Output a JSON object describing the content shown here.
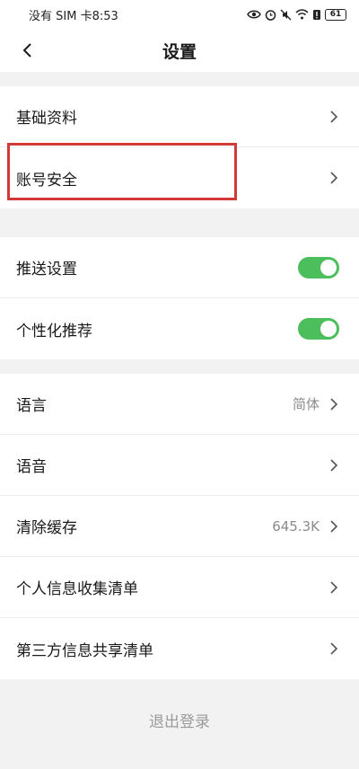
{
  "status_bar": {
    "carrier_time": "没有 SIM 卡8:53",
    "battery": "61"
  },
  "header": {
    "title": "设置"
  },
  "group1": [
    {
      "label": "基础资料"
    },
    {
      "label": "账号安全"
    }
  ],
  "group2": [
    {
      "label": "推送设置",
      "enabled": true
    },
    {
      "label": "个性化推荐",
      "enabled": true
    }
  ],
  "group3": [
    {
      "label": "语言",
      "value": "简体"
    },
    {
      "label": "语音"
    },
    {
      "label": "清除缓存",
      "value": "645.3K"
    },
    {
      "label": "个人信息收集清单"
    },
    {
      "label": "第三方信息共享清单"
    }
  ],
  "logout_label": "退出登录",
  "colors": {
    "toggle_on": "#4cbe5c",
    "highlight": "#d23a3a"
  }
}
